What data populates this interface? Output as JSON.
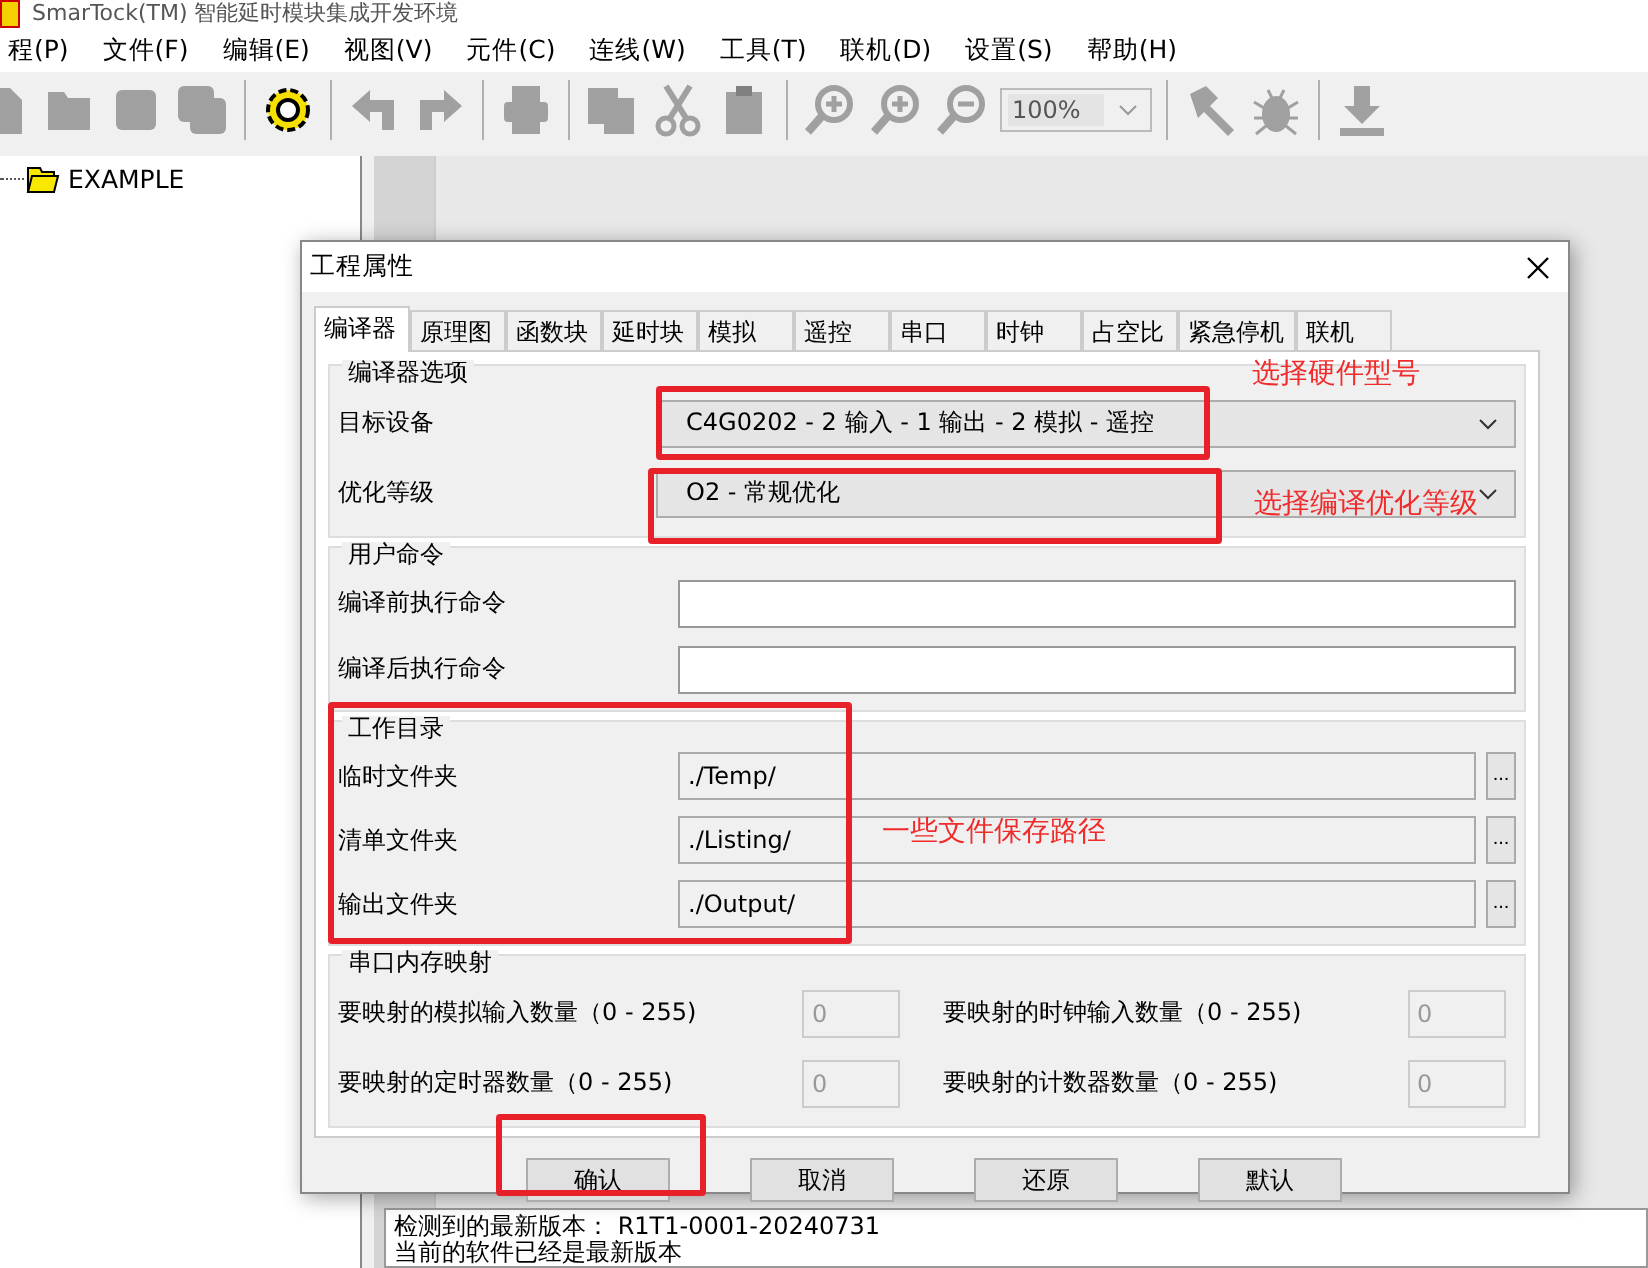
{
  "window": {
    "title": "SmarTock(TM) 智能延时模块集成开发环境"
  },
  "menu": [
    "程(P)",
    "文件(F)",
    "编辑(E)",
    "视图(V)",
    "元件(C)",
    "连线(W)",
    "工具(T)",
    "联机(D)",
    "设置(S)",
    "帮助(H)"
  ],
  "toolbar": {
    "zoom": "100%"
  },
  "project_tree": [
    {
      "label": "EXAMPLE"
    }
  ],
  "dialog": {
    "title": "工程属性",
    "tabs": [
      {
        "label": "编译器",
        "selected": true
      },
      {
        "label": "原理图",
        "selected": false
      },
      {
        "label": "函数块",
        "selected": false
      },
      {
        "label": "延时块",
        "selected": false
      },
      {
        "label": "模拟",
        "selected": false
      },
      {
        "label": "遥控",
        "selected": false
      },
      {
        "label": "串口",
        "selected": false
      },
      {
        "label": "时钟",
        "selected": false
      },
      {
        "label": "占空比",
        "selected": false
      },
      {
        "label": "紧急停机",
        "selected": false
      },
      {
        "label": "联机",
        "selected": false
      }
    ],
    "groups": [
      {
        "title": "编译器选项",
        "kind": "form",
        "rows": [
          {
            "kind": "select",
            "label": "目标设备",
            "value": "C4G0202 - 2 输入 - 1 输出 - 2 模拟 - 遥控"
          },
          {
            "kind": "select",
            "label": "优化等级",
            "value": "O2 - 常规优化"
          }
        ]
      },
      {
        "title": "用户命令",
        "kind": "form",
        "rows": [
          {
            "kind": "input",
            "label": "编译前执行命令",
            "value": ""
          },
          {
            "kind": "input",
            "label": "编译后执行命令",
            "value": ""
          }
        ]
      },
      {
        "title": "工作目录",
        "kind": "form",
        "rows": [
          {
            "kind": "path",
            "label": "临时文件夹",
            "value": "./Temp/",
            "button": "..."
          },
          {
            "kind": "path",
            "label": "清单文件夹",
            "value": "./Listing/",
            "button": "..."
          },
          {
            "kind": "path",
            "label": "输出文件夹",
            "value": "./Output/",
            "button": "..."
          }
        ]
      },
      {
        "title": "串口内存映射",
        "kind": "grid",
        "rows": [
          {
            "kind": "number",
            "label": "要映射的模拟输入数量（0 - 255)",
            "value": "0",
            "disabled": true
          },
          {
            "kind": "number",
            "label": "要映射的时钟输入数量（0 - 255)",
            "value": "0",
            "disabled": true
          },
          {
            "kind": "number",
            "label": "要映射的定时器数量（0 - 255)",
            "value": "0",
            "disabled": true
          },
          {
            "kind": "number",
            "label": "要映射的计数器数量（0 - 255)",
            "value": "0",
            "disabled": true
          }
        ]
      }
    ],
    "buttons": [
      "确认",
      "取消",
      "还原",
      "默认"
    ]
  },
  "annotations": [
    {
      "kind": "box"
    },
    {
      "kind": "box"
    },
    {
      "kind": "box"
    },
    {
      "kind": "box"
    },
    {
      "kind": "text",
      "text": "选择硬件型号"
    },
    {
      "kind": "text",
      "text": "选择编译优化等级"
    },
    {
      "kind": "text",
      "text": "一些文件保存路径"
    }
  ],
  "log": [
    "检测到的最新版本：  R1T1-0001-20240731",
    "当前的软件已经是最新版本"
  ]
}
